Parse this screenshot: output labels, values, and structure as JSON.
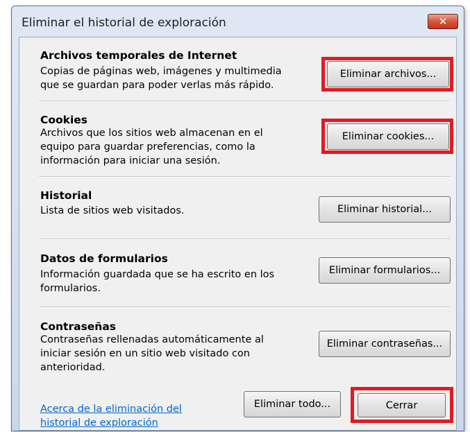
{
  "window": {
    "title": "Eliminar el historial de exploración",
    "close_glyph": "✕"
  },
  "sections": [
    {
      "title": "Archivos temporales de Internet",
      "desc_lines": [
        "Copias de páginas web, imágenes y multimedia",
        "que se guardan para poder verlas más rápido."
      ],
      "button": "Eliminar archivos..."
    },
    {
      "title": "Cookies",
      "desc_lines": [
        "Archivos que los sitios web almacenan en el",
        "equipo para guardar preferencias, como la",
        "información para iniciar una sesión."
      ],
      "button": "Eliminar cookies..."
    },
    {
      "title": "Historial",
      "desc_lines": [
        "Lista de sitios web visitados."
      ],
      "button": "Eliminar historial..."
    },
    {
      "title": "Datos de formularios",
      "desc_lines": [
        "Información guardada que se ha escrito en los",
        "formularios."
      ],
      "button": "Eliminar formularios..."
    },
    {
      "title": "Contraseñas",
      "desc_lines": [
        "Contraseñas rellenadas automáticamente al",
        "iniciar sesión en un sitio web visitado con",
        "anterioridad."
      ],
      "button": "Eliminar contraseñas..."
    }
  ],
  "footer": {
    "link_lines": [
      "Acerca de la eliminación del",
      "historial de exploración"
    ],
    "delete_all": "Eliminar todo...",
    "close": "Cerrar"
  },
  "colors": {
    "highlight": "#e21b22",
    "link": "#0066cc"
  }
}
